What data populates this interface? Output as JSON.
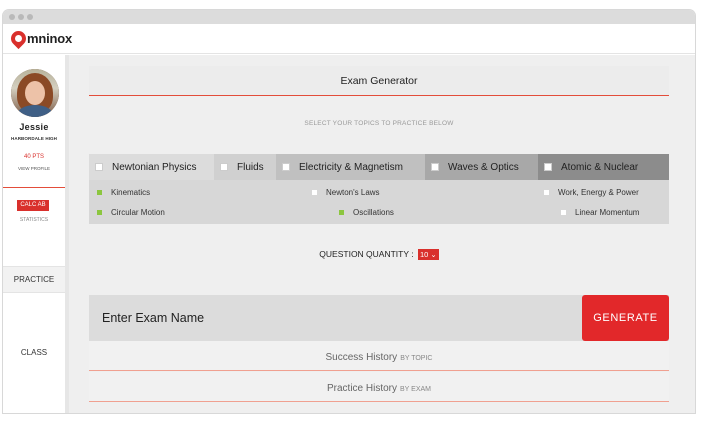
{
  "app": {
    "logo_text": "mninox",
    "accent": "#e2282a"
  },
  "sidebar": {
    "user_name": "Jessie",
    "school": "HARBORDALE HIGH",
    "points": "40 PTS",
    "view_profile": "VIEW PROFILE",
    "course_badge": "CALC AB",
    "statistics": "STATISTICS",
    "nav": [
      {
        "label": "PRACTICE",
        "active": true
      },
      {
        "label": "CLASS",
        "active": false
      }
    ]
  },
  "main": {
    "title": "Exam Generator",
    "subtitle": "SELECT YOUR TOPICS TO PRACTICE BELOW",
    "topics": [
      {
        "label": "Newtonian Physics"
      },
      {
        "label": "Fluids"
      },
      {
        "label": "Electricity & Magnetism"
      },
      {
        "label": "Waves & Optics"
      },
      {
        "label": "Atomic & Nuclear"
      }
    ],
    "subtopics": [
      {
        "label": "Kinematics",
        "selected": true
      },
      {
        "label": "Newton's Laws",
        "selected": false
      },
      {
        "label": "Work, Energy & Power",
        "selected": false
      },
      {
        "label": "Circular Motion",
        "selected": true
      },
      {
        "label": "Oscillations",
        "selected": true
      },
      {
        "label": "Linear Momentum",
        "selected": false
      }
    ],
    "quantity_label": "QUESTION QUANTITY :",
    "quantity_value": "10",
    "exam_name_placeholder": "Enter Exam Name",
    "generate_label": "GENERATE",
    "history": [
      {
        "label": "Success History",
        "suffix": "BY TOPIC"
      },
      {
        "label": "Practice History",
        "suffix": "BY EXAM"
      }
    ]
  }
}
